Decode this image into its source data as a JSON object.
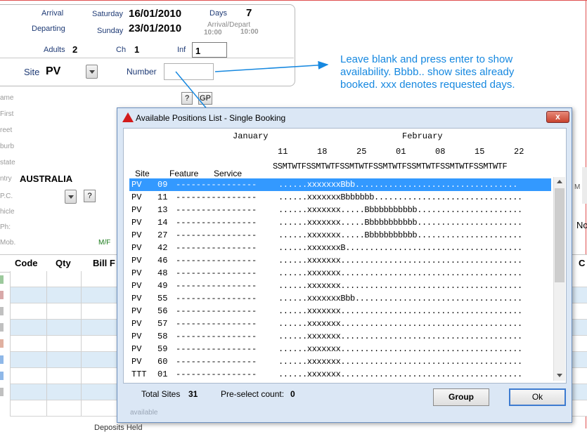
{
  "booking": {
    "arrival_label": "Arrival",
    "arrival_day": "Saturday",
    "arrival_date": "16/01/2010",
    "departing_label": "Departing",
    "departing_day": "Sunday",
    "departing_date": "23/01/2010",
    "days_label": "Days",
    "days_value": "7",
    "arrdep_label": "Arrival/Depart",
    "arr_time": "10:00",
    "dep_time": "10:00",
    "adults_label": "Adults",
    "adults_value": "2",
    "ch_label": "Ch",
    "ch_value": "1",
    "inf_label": "Inf",
    "inf_value": "1",
    "site_label": "Site",
    "site_value": "PV",
    "number_label": "Number",
    "q_btn": "?",
    "gp_btn": "GP"
  },
  "side_labels": [
    "ame",
    "First",
    "reet",
    "burb",
    "state",
    "ntry",
    "P.C.",
    "hicle",
    "Ph:",
    "Mob."
  ],
  "country_value": "AUSTRALIA",
  "pc_q_btn": "?",
  "mf_label": "M/F",
  "annotation": "Leave blank and press enter to show availability. Bbbb.. show sites already booked. xxx denotes requested days.",
  "grid": {
    "headers": [
      "Code",
      "Qty",
      "Bill F"
    ],
    "right_header": "C",
    "right_m": "M",
    "right_no": "No",
    "bottom_text": "Deposits Held"
  },
  "dialog": {
    "title": "Available Positions List - Single Booking",
    "close_label": "x",
    "month1": "January",
    "month2": "February",
    "day_numbers": [
      "11",
      "18",
      "25",
      "01",
      "08",
      "15",
      "22"
    ],
    "weekday_line": "SSMTWTFSSMTWTFSSMTWTFSSMTWTFSSMTWTFSSMTWTFSSMTWTF",
    "col_site": "Site",
    "col_feature": "Feature",
    "col_service": "Service",
    "rows": [
      {
        "site": "PV",
        "num": "09",
        "feature": "----------------",
        "avail": "......xxxxxxxBbb.................................."
      },
      {
        "site": "PV",
        "num": "11",
        "feature": "----------------",
        "avail": "......xxxxxxxBbbbbbb..............................."
      },
      {
        "site": "PV",
        "num": "13",
        "feature": "----------------",
        "avail": "......xxxxxxx.....Bbbbbbbbbbb......................"
      },
      {
        "site": "PV",
        "num": "14",
        "feature": "----------------",
        "avail": "......xxxxxxx.....Bbbbbbbbbbb......................"
      },
      {
        "site": "PV",
        "num": "27",
        "feature": "----------------",
        "avail": "......xxxxxxx.....Bbbbbbbbbbb......................"
      },
      {
        "site": "PV",
        "num": "42",
        "feature": "----------------",
        "avail": "......xxxxxxxB....................................."
      },
      {
        "site": "PV",
        "num": "46",
        "feature": "----------------",
        "avail": "......xxxxxxx......................................"
      },
      {
        "site": "PV",
        "num": "48",
        "feature": "----------------",
        "avail": "......xxxxxxx......................................"
      },
      {
        "site": "PV",
        "num": "49",
        "feature": "----------------",
        "avail": "......xxxxxxx......................................"
      },
      {
        "site": "PV",
        "num": "55",
        "feature": "----------------",
        "avail": "......xxxxxxxBbb..................................."
      },
      {
        "site": "PV",
        "num": "56",
        "feature": "----------------",
        "avail": "......xxxxxxx......................................"
      },
      {
        "site": "PV",
        "num": "57",
        "feature": "----------------",
        "avail": "......xxxxxxx......................................"
      },
      {
        "site": "PV",
        "num": "58",
        "feature": "----------------",
        "avail": "......xxxxxxx......................................"
      },
      {
        "site": "PV",
        "num": "59",
        "feature": "----------------",
        "avail": "......xxxxxxx......................................"
      },
      {
        "site": "PV",
        "num": "60",
        "feature": "----------------",
        "avail": "......xxxxxxx......................................"
      },
      {
        "site": "TTT",
        "num": "01",
        "feature": "----------------",
        "avail": "......xxxxxxx......................................"
      }
    ],
    "total_sites_label": "Total Sites",
    "total_sites_value": "31",
    "preselect_label": "Pre-select count:",
    "preselect_value": "0",
    "group_btn": "Group",
    "ok_btn": "Ok",
    "available_label": "available"
  },
  "colors": {
    "annotation": "#1688e0",
    "selection": "#3399ff",
    "grid_alt_row": "#dcebf7"
  }
}
